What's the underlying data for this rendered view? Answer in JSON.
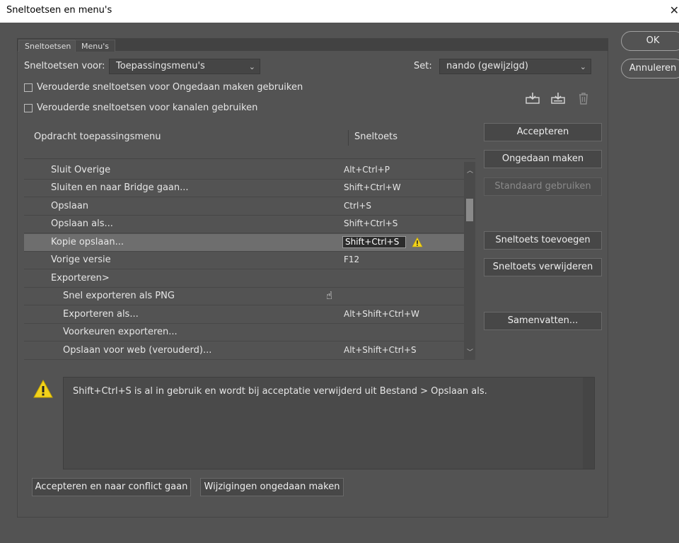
{
  "window": {
    "title": "Sneltoetsen en menu's"
  },
  "tabs": [
    "Sneltoetsen",
    "Menu's"
  ],
  "controls": {
    "sneltoetsen_voor_label": "Sneltoetsen voor:",
    "sneltoetsen_voor_value": "Toepassingsmenu's",
    "set_label": "Set:",
    "set_value": "nando (gewijzigd)",
    "checkbox1": "Verouderde sneltoetsen voor Ongedaan maken gebruiken",
    "checkbox2": "Verouderde sneltoetsen voor kanalen gebruiken"
  },
  "table": {
    "col_command": "Opdracht toepassingsmenu",
    "col_shortcut": "Sneltoets",
    "rows": [
      {
        "cmd": "Sluit Overige",
        "sc": "Alt+Ctrl+P"
      },
      {
        "cmd": "Sluiten en naar Bridge gaan...",
        "sc": "Shift+Ctrl+W"
      },
      {
        "cmd": "Opslaan",
        "sc": "Ctrl+S"
      },
      {
        "cmd": "Opslaan als...",
        "sc": "Shift+Ctrl+S"
      },
      {
        "cmd": "Kopie opslaan...",
        "sc": "Shift+Ctrl+S"
      },
      {
        "cmd": "Vorige versie",
        "sc": "F12"
      },
      {
        "cmd": "Exporteren>",
        "sc": ""
      },
      {
        "cmd": "Snel exporteren als PNG",
        "sc": ""
      },
      {
        "cmd": "Exporteren als...",
        "sc": "Alt+Shift+Ctrl+W"
      },
      {
        "cmd": "Voorkeuren exporteren...",
        "sc": ""
      },
      {
        "cmd": "Opslaan voor web (verouderd)...",
        "sc": "Alt+Shift+Ctrl+S"
      }
    ]
  },
  "buttons": {
    "ok": "OK",
    "cancel": "Annuleren",
    "accept": "Accepteren",
    "undo": "Ongedaan maken",
    "use_default": "Standaard gebruiken",
    "add_shortcut": "Sneltoets toevoegen",
    "remove_shortcut": "Sneltoets verwijderen",
    "summarize": "Samenvatten...",
    "accept_goto_conflict": "Accepteren en naar conflict gaan",
    "undo_changes": "Wijzigingen ongedaan maken"
  },
  "message": "Shift+Ctrl+S is al in gebruik en wordt bij acceptatie verwijderd uit  Bestand > Opslaan als.",
  "colors": {
    "warning": "#f2d21b",
    "background": "#535353"
  }
}
